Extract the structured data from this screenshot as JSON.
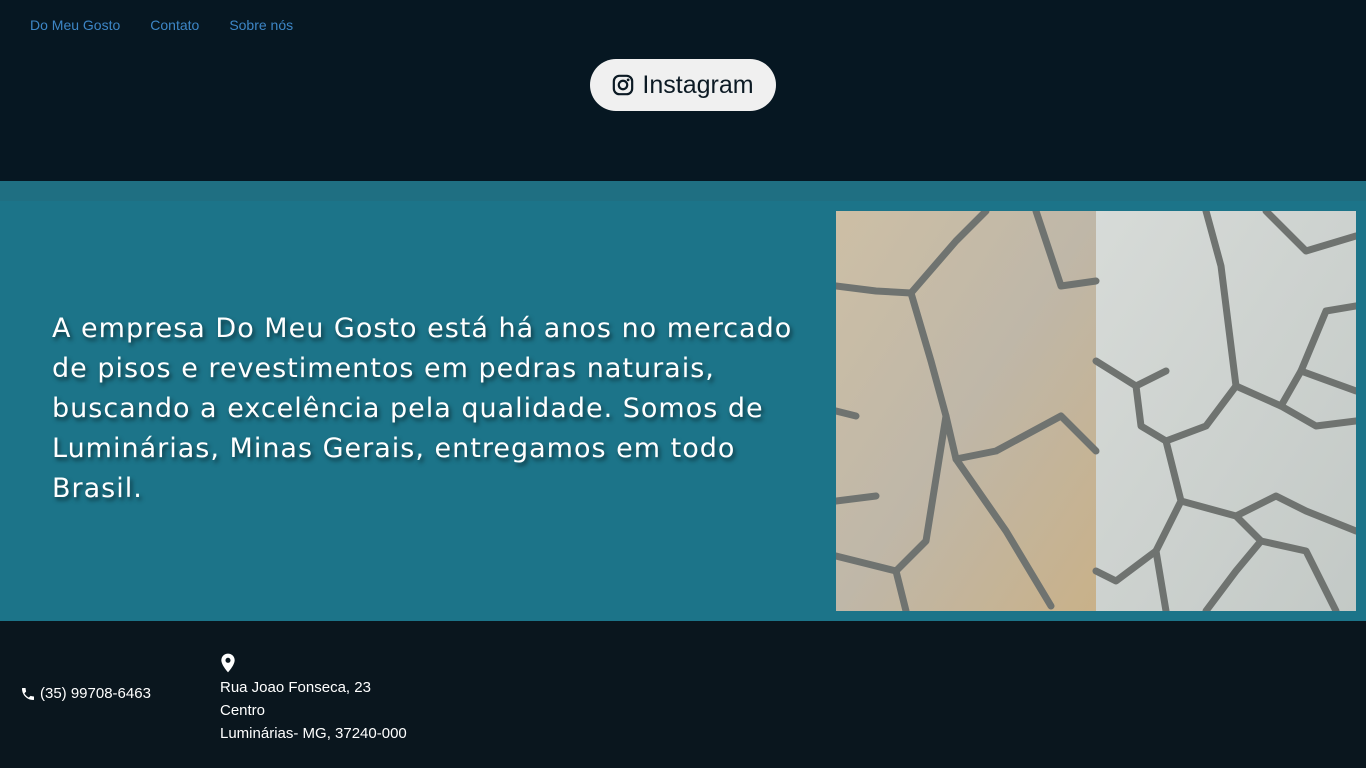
{
  "nav": {
    "items": [
      {
        "label": "Do Meu Gosto"
      },
      {
        "label": "Contato"
      },
      {
        "label": "Sobre nós"
      }
    ]
  },
  "instagram": {
    "label": "Instagram",
    "icon": "instagram-icon"
  },
  "about": {
    "text": "A empresa Do Meu Gosto está há anos no mercado de pisos e revestimentos em pedras naturais, buscando a excelência pela qualidade. Somos de Luminárias, Minas Gerais, entregamos em todo Brasil."
  },
  "footer": {
    "phone": "(35) 99708-6463",
    "phone_icon": "phone-icon",
    "address_icon": "map-pin-icon",
    "address_lines": [
      "Rua Joao Fonseca, 23",
      "Centro",
      "Luminárias- MG, 37240-000"
    ]
  },
  "colors": {
    "header_bg": "#061722",
    "band_bg": "#1c7489",
    "footer_bg": "#0a161e",
    "nav_link": "#3d86c6"
  }
}
